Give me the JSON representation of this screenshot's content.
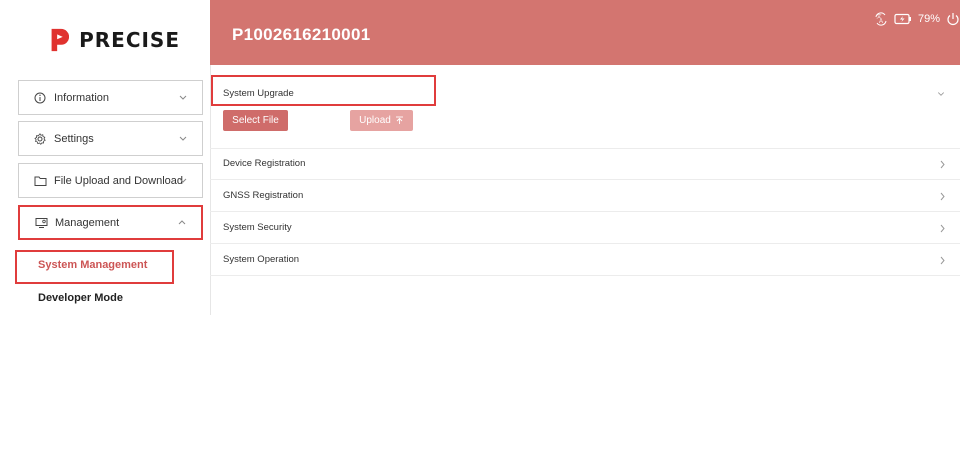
{
  "brand": {
    "logo_text": "PRECISE",
    "logo_icon": "precise-logo-icon",
    "accent": "#d37570"
  },
  "header": {
    "device_id": "P1002616210001",
    "battery": "79%",
    "icons": [
      "language-icon",
      "battery-icon",
      "power-icon"
    ]
  },
  "sidebar": {
    "items": [
      {
        "label": "Information",
        "icon": "info-icon",
        "expanded": false
      },
      {
        "label": "Settings",
        "icon": "gear-icon",
        "expanded": false
      },
      {
        "label": "File Upload and Download",
        "icon": "folder-icon",
        "expanded": false
      },
      {
        "label": "Management",
        "icon": "management-icon",
        "expanded": true
      }
    ],
    "sub_items": [
      {
        "label": "System Management",
        "selected": true
      },
      {
        "label": "Developer Mode",
        "selected": false
      }
    ]
  },
  "main": {
    "sections": [
      {
        "label": "System Upgrade",
        "expanded": true
      },
      {
        "label": "Device Registration",
        "expanded": false
      },
      {
        "label": "GNSS Registration",
        "expanded": false
      },
      {
        "label": "System Security",
        "expanded": false
      },
      {
        "label": "System Operation",
        "expanded": false
      }
    ],
    "buttons": {
      "select_file": "Select File",
      "upload": "Upload"
    }
  }
}
